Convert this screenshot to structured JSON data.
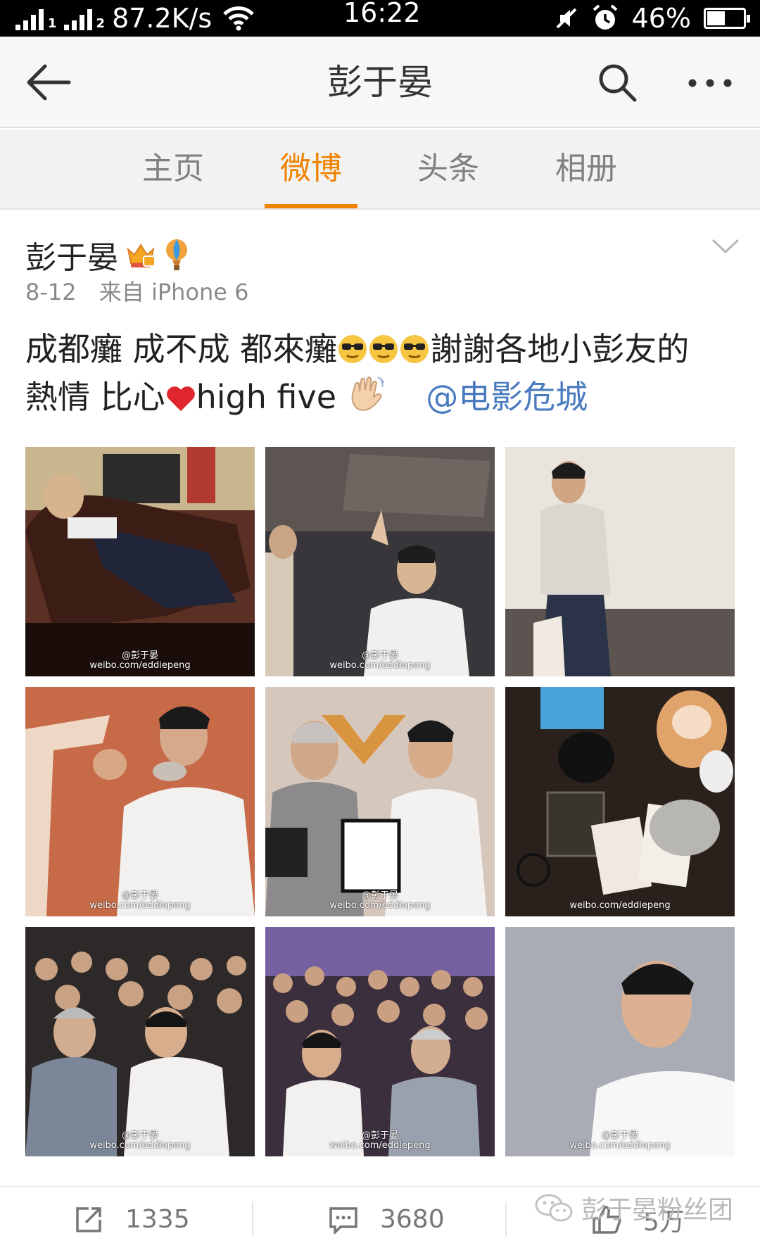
{
  "status_bar": {
    "signal_1_label": "1",
    "signal_2_label": "2",
    "network_speed": "87.2K/s",
    "time": "16:22",
    "battery_percent": "46%",
    "battery_level": 0.46
  },
  "navbar": {
    "title": "彭于晏",
    "back_icon": "arrow-left-icon",
    "search_icon": "search-icon",
    "more_icon": "more-icon"
  },
  "tabs": [
    {
      "label": "主页",
      "active": false
    },
    {
      "label": "微博",
      "active": true
    },
    {
      "label": "头条",
      "active": false
    },
    {
      "label": "相册",
      "active": false
    }
  ],
  "post": {
    "author": "彭于晏",
    "date": "8-12",
    "source": "来自 iPhone 6",
    "text_line1_a": "成都癱 成不成 都來癱",
    "text_line1_b": "謝謝各地小彭友的",
    "text_line2_a": "熱情 比心",
    "text_line2_b": "high five",
    "mention": "@电影危城",
    "photo_watermarks": [
      [
        "@彭于晏",
        "weibo.com/eddiepeng"
      ],
      [
        "@彭于晏",
        "weibo.com/eddiepeng"
      ],
      [
        "",
        ""
      ],
      [
        "@彭于晏",
        "weibo.com/eddiepeng"
      ],
      [
        "@彭于晏",
        "weibo.com/eddiepeng"
      ],
      [
        "",
        "weibo.com/eddiepeng"
      ],
      [
        "@彭于晏",
        "weibo.com/eddiepeng"
      ],
      [
        "@彭于晏",
        "weibo.com/eddiepeng"
      ],
      [
        "@彭于晏",
        "weibo.com/eddiepeng"
      ]
    ]
  },
  "actions": {
    "repost_count": "1335",
    "comment_count": "3680",
    "like_count": "5万"
  },
  "watermark": "彭于晏粉丝团",
  "colors": {
    "accent": "#f08200",
    "mention": "#4a7bbf"
  }
}
